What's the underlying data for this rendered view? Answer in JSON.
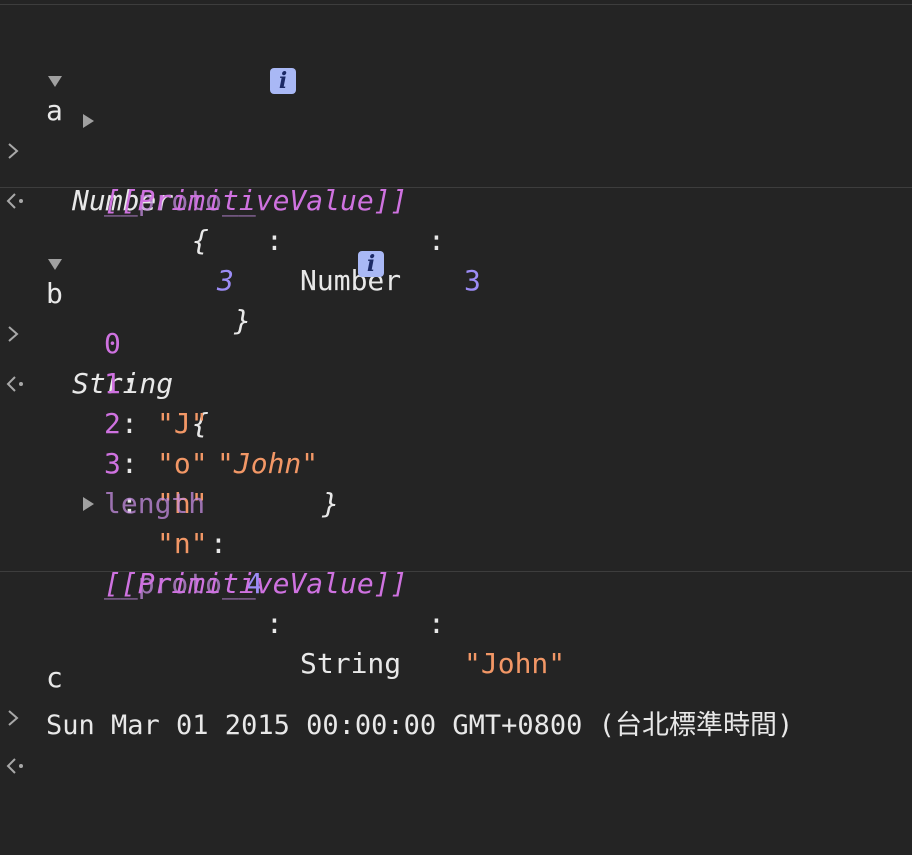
{
  "entries": {
    "a": {
      "input": "a",
      "type": "Number",
      "brace_open": " {",
      "brace_value": "3",
      "brace_close": "}",
      "info": "i",
      "proto_key": "__proto__",
      "proto_sep": ": ",
      "proto_value": "Number",
      "prim_key": "[[PrimitiveValue]]",
      "prim_sep": ": ",
      "prim_value": "3"
    },
    "b": {
      "input": "b",
      "type": "String",
      "brace_open": " {",
      "brace_value": "\"John\"",
      "brace_close": "}",
      "info": "i",
      "chars": [
        {
          "key": "0",
          "value": "\"J\""
        },
        {
          "key": "1",
          "value": "\"o\""
        },
        {
          "key": "2",
          "value": "\"h\""
        },
        {
          "key": "3",
          "value": "\"n\""
        }
      ],
      "sep": ": ",
      "length_key": "length",
      "length_value": "4",
      "proto_key": "__proto__",
      "proto_value": "String",
      "prim_key": "[[PrimitiveValue]]",
      "prim_value": "\"John\""
    },
    "c": {
      "input": "c",
      "output": "Sun Mar 01 2015 00:00:00 GMT+0800 (台北標準時間)"
    }
  },
  "colors": {
    "background": "#242424",
    "number": "#9c8cf6",
    "string": "#f29766",
    "key": "#cf72e0",
    "text": "#e8e8e8",
    "info_badge": "#a9b8f5"
  },
  "icons": {
    "input_prompt": "chevron-right-icon",
    "output_prompt": "return-arrow-icon",
    "expanded": "triangle-down-icon",
    "collapsed": "triangle-right-icon",
    "info": "info-icon"
  }
}
